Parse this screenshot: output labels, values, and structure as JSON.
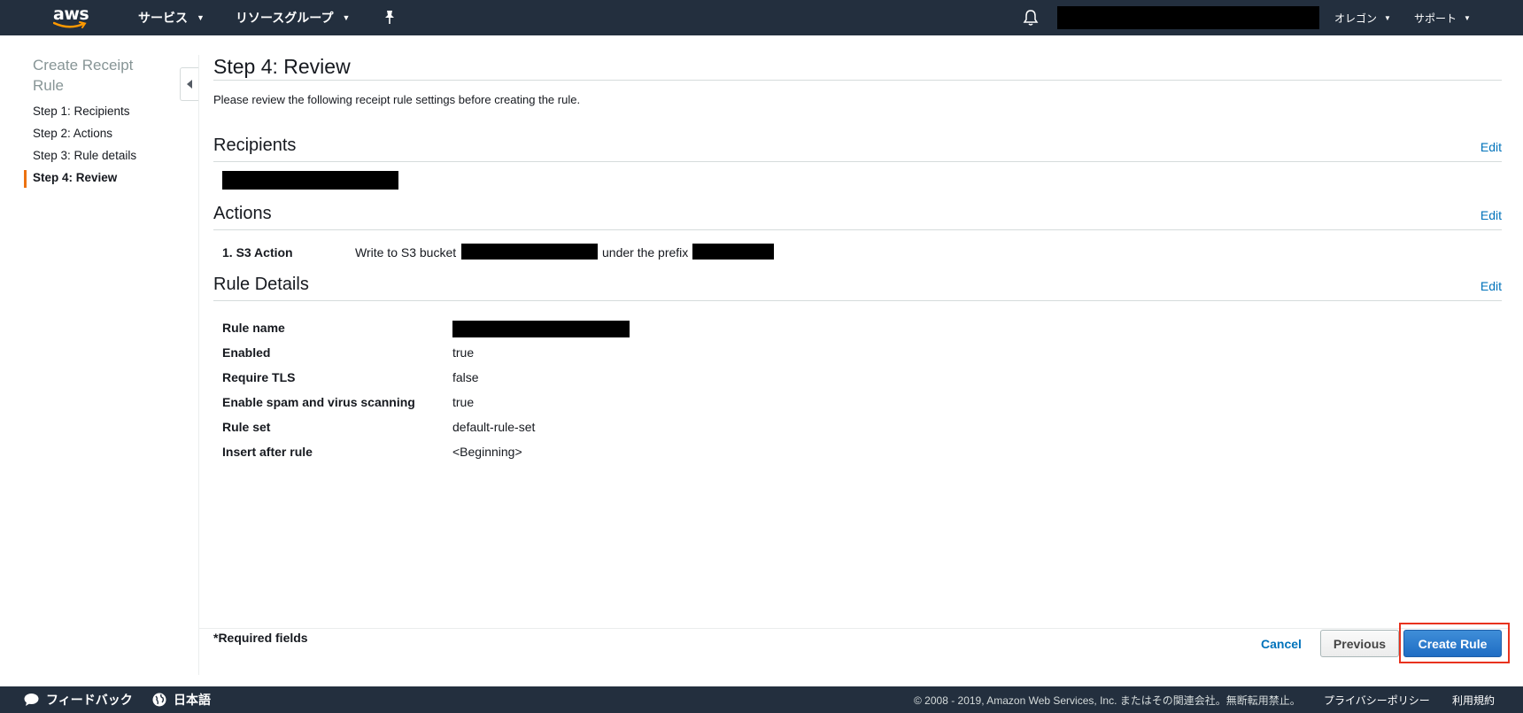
{
  "header": {
    "logo_text": "aws",
    "services_label": "サービス",
    "resource_groups_label": "リソースグループ",
    "region_label": "オレゴン",
    "support_label": "サポート"
  },
  "sidebar": {
    "title": "Create Receipt Rule",
    "items": [
      {
        "label": "Step 1: Recipients"
      },
      {
        "label": "Step 2: Actions"
      },
      {
        "label": "Step 3: Rule details"
      },
      {
        "label": "Step 4: Review",
        "active": true
      }
    ]
  },
  "main": {
    "title": "Step 4: Review",
    "intro": "Please review the following receipt rule settings before creating the rule.",
    "edit_label": "Edit",
    "recipients": {
      "title": "Recipients"
    },
    "actions": {
      "title": "Actions",
      "action_label": "1. S3 Action",
      "text_before_bucket": "Write to S3 bucket",
      "text_before_prefix": "under the prefix"
    },
    "rule_details": {
      "title": "Rule Details",
      "rows": [
        {
          "label": "Rule name",
          "value": ""
        },
        {
          "label": "Enabled",
          "value": "true"
        },
        {
          "label": "Require TLS",
          "value": "false"
        },
        {
          "label": "Enable spam and virus scanning",
          "value": "true"
        },
        {
          "label": "Rule set",
          "value": "default-rule-set"
        },
        {
          "label": "Insert after rule",
          "value": "<Beginning>"
        }
      ]
    }
  },
  "footer_actions": {
    "required_note": "*Required fields",
    "cancel_label": "Cancel",
    "previous_label": "Previous",
    "create_label": "Create Rule"
  },
  "bottom_bar": {
    "feedback_label": "フィードバック",
    "language_label": "日本語",
    "copyright": "© 2008 - 2019, Amazon Web Services, Inc. またはその関連会社。無断転用禁止。",
    "privacy_label": "プライバシーポリシー",
    "terms_label": "利用規約"
  },
  "colors": {
    "nav_bg": "#232f3e",
    "link": "#0073bb",
    "primary_button": "#1f6dc4",
    "active_marker": "#ec7211",
    "highlight_outline": "#e8321e"
  }
}
